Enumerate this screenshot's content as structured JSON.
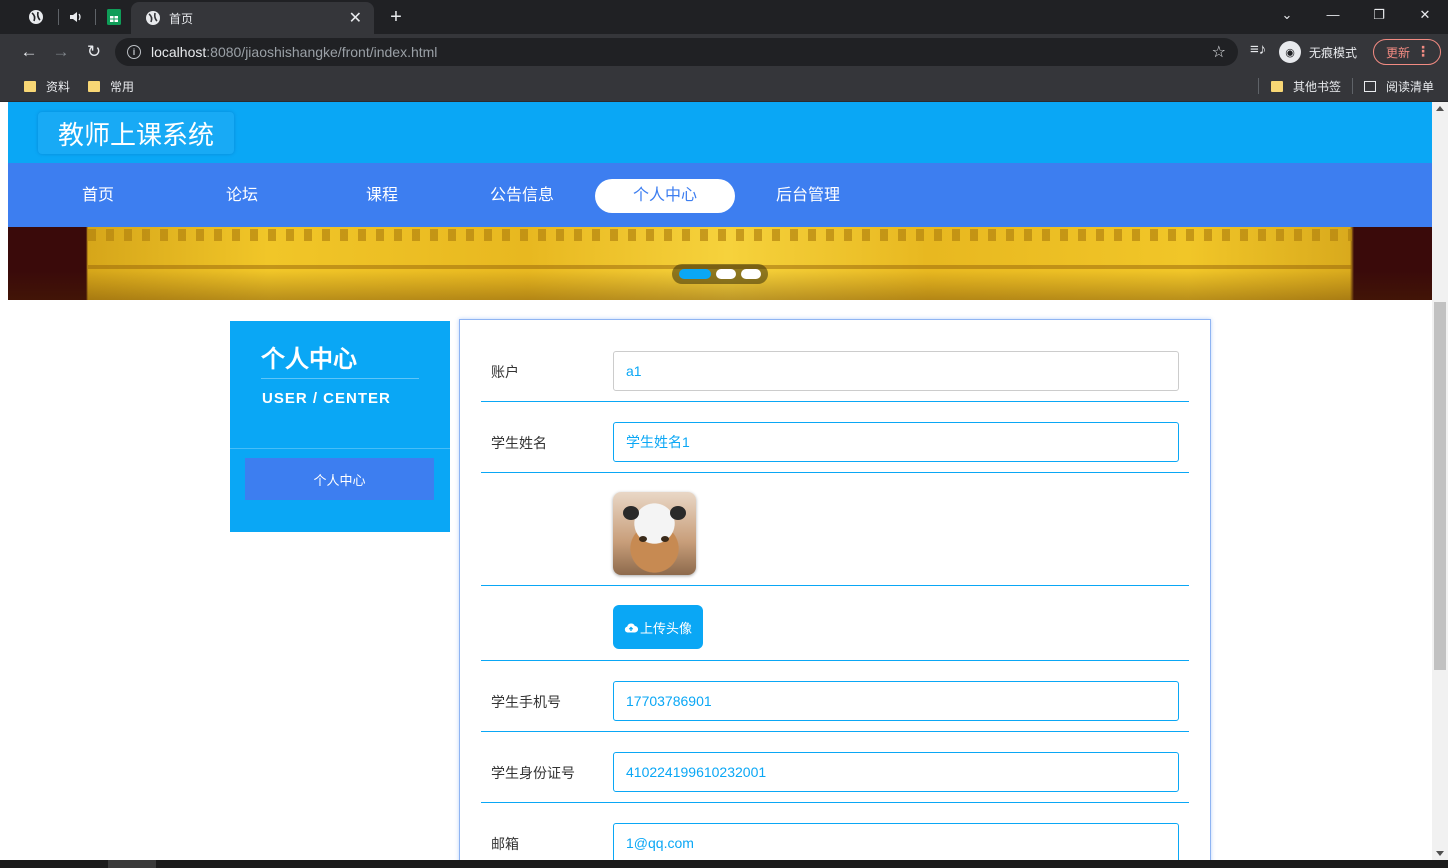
{
  "browser": {
    "tab_title": "首页",
    "url_host": "localhost",
    "url_rest": ":8080/jiaoshishangke/front/index.html",
    "incognito_label": "无痕模式",
    "update_label": "更新",
    "bookmarks": [
      "资料",
      "常用"
    ],
    "other_bookmarks": "其他书签",
    "reading_list": "阅读清单"
  },
  "site": {
    "logo": "教师上课系统",
    "nav": [
      "首页",
      "论坛",
      "课程",
      "公告信息",
      "个人中心",
      "后台管理"
    ],
    "active_nav": "个人中心"
  },
  "sidebar": {
    "title": "个人中心",
    "subtitle": "USER / CENTER",
    "menu": [
      "个人中心"
    ]
  },
  "form": {
    "account_label": "账户",
    "account_value": "a1",
    "name_label": "学生姓名",
    "name_value": "学生姓名1",
    "upload_label": "上传头像",
    "phone_label": "学生手机号",
    "phone_value": "17703786901",
    "idcard_label": "学生身份证号",
    "idcard_value": "410224199610232001",
    "email_label": "邮箱",
    "email_value": "1@qq.com"
  },
  "carousel": {
    "slide_count": 3,
    "active_index": 0
  },
  "colors": {
    "header": "#0aa7f5",
    "nav": "#3d7ef0",
    "accent": "#0aa7f5"
  }
}
